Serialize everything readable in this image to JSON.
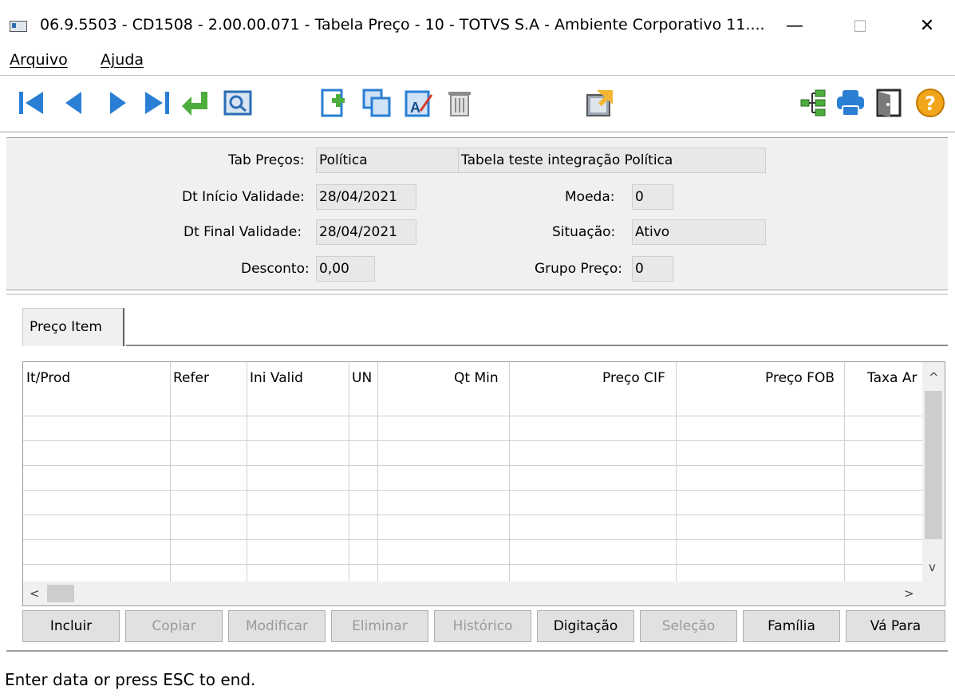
{
  "window": {
    "title": "06.9.5503 - CD1508 - 2.00.00.071 - Tabela Preço - 10 - TOTVS S.A - Ambiente Corporativo 11....",
    "minimize_glyph": "—",
    "maximize_glyph": "☐",
    "close_glyph": "✕"
  },
  "menu": {
    "items": [
      "Arquivo",
      "Ajuda"
    ]
  },
  "toolbar": {
    "icons": [
      "first-record-icon",
      "previous-record-icon",
      "next-record-icon",
      "last-record-icon",
      "return-icon",
      "search-zoom-icon",
      "new-document-icon",
      "copy-icon",
      "edit-icon",
      "delete-icon",
      "export-icon",
      "tree-icon",
      "print-icon",
      "exit-door-icon",
      "help-icon"
    ],
    "help_glyph": "?"
  },
  "header": {
    "tab_precos_label": "Tab Preços:",
    "tab_precos_value": "Política",
    "tab_precos_desc": "Tabela teste integração Política",
    "dt_inicio_label": "Dt Início Validade:",
    "dt_inicio_value": "28/04/2021",
    "moeda_label": "Moeda:",
    "moeda_value": "0",
    "dt_final_label": "Dt Final Validade:",
    "dt_final_value": "28/04/2021",
    "situacao_label": "Situação:",
    "situacao_value": "Ativo",
    "desconto_label": "Desconto:",
    "desconto_value": "0,00",
    "grupo_preco_label": "Grupo Preço:",
    "grupo_preco_value": "0"
  },
  "tabs": [
    "Preço Item"
  ],
  "grid": {
    "columns": [
      "It/Prod",
      "Refer",
      "Ini Valid",
      "UN",
      "Qt Min",
      "Preço CIF",
      "Preço FOB",
      "Taxa Ar"
    ],
    "rows": []
  },
  "scroll": {
    "up": "^",
    "down": "v",
    "left": "<",
    "right": ">"
  },
  "buttons": [
    {
      "label": "Incluir",
      "enabled": true
    },
    {
      "label": "Copiar",
      "enabled": false
    },
    {
      "label": "Modificar",
      "enabled": false
    },
    {
      "label": "Eliminar",
      "enabled": false
    },
    {
      "label": "Histórico",
      "enabled": false
    },
    {
      "label": "Digitação",
      "enabled": true
    },
    {
      "label": "Seleção",
      "enabled": false
    },
    {
      "label": "Família",
      "enabled": true
    },
    {
      "label": "Vá Para",
      "enabled": true
    }
  ],
  "status": {
    "text": "Enter data or press ESC to end."
  }
}
